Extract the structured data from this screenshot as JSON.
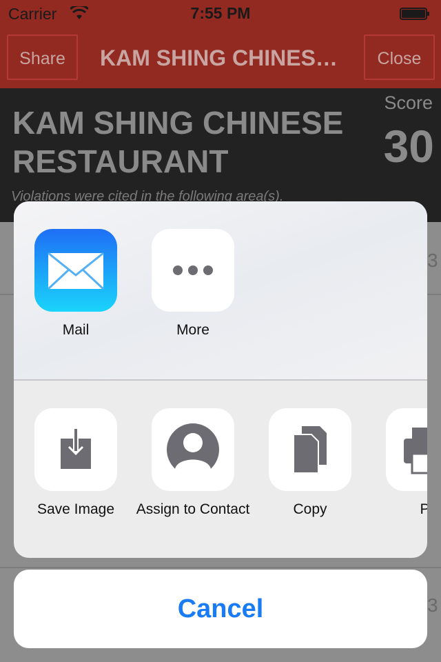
{
  "status_bar": {
    "carrier": "Carrier",
    "time": "7:55 PM"
  },
  "nav": {
    "share_label": "Share",
    "title": "KAM SHING CHINES…",
    "close_label": "Close"
  },
  "restaurant": {
    "name": "KAM SHING CHINESE RESTAURANT",
    "score_label": "Score",
    "score_value": "30",
    "violations_intro": "Violations were cited in the following area(s)."
  },
  "background_partials": [
    "3",
    "3"
  ],
  "share_sheet": {
    "apps": [
      {
        "label": "Mail",
        "icon": "mail-icon"
      },
      {
        "label": "More",
        "icon": "more-icon"
      }
    ],
    "actions": [
      {
        "label": "Save Image",
        "icon": "save-image-icon"
      },
      {
        "label": "Assign to Contact",
        "icon": "contact-icon"
      },
      {
        "label": "Copy",
        "icon": "copy-icon"
      },
      {
        "label": "Pr",
        "icon": "print-icon"
      }
    ],
    "cancel_label": "Cancel"
  },
  "colors": {
    "accent": "#1a7cf5",
    "nav_bar": "#922a22",
    "header": "#222222"
  }
}
